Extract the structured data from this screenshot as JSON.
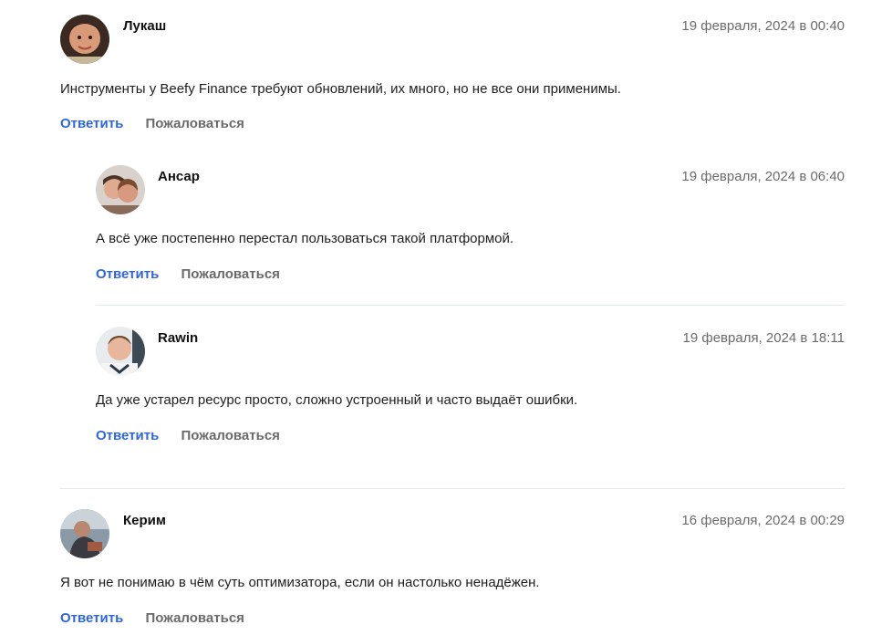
{
  "comments": [
    {
      "author": "Лукаш",
      "date": "19 февраля, 2024 в 00:40",
      "text": "Инструменты у Beefy Finance требуют обновлений, их много, но не все они применимы.",
      "reply_label": "Ответить",
      "report_label": "Пожаловаться",
      "avatar_icon": "user-avatar-icon",
      "replies": [
        {
          "author": "Ансар",
          "date": "19 февраля, 2024 в 06:40",
          "text": "А всё уже постепенно перестал пользоваться такой платформой.",
          "reply_label": "Ответить",
          "report_label": "Пожаловаться",
          "avatar_icon": "user-avatar-icon"
        },
        {
          "author": "Rawin",
          "date": "19 февраля, 2024 в 18:11",
          "text": "Да уже устарел ресурс просто, сложно устроенный и часто выдаёт ошибки.",
          "reply_label": "Ответить",
          "report_label": "Пожаловаться",
          "avatar_icon": "user-avatar-icon"
        }
      ]
    },
    {
      "author": "Керим",
      "date": "16 февраля, 2024 в 00:29",
      "text": "Я вот не понимаю в чём суть оптимизатора, если он настолько ненадёжен.",
      "reply_label": "Ответить",
      "report_label": "Пожаловаться",
      "avatar_icon": "user-avatar-icon",
      "replies": []
    }
  ],
  "colors": {
    "reply_link": "#2f66e0",
    "report_link": "#6a6a6a",
    "date": "#6b6b6b",
    "divider": "#e4e8f0"
  }
}
